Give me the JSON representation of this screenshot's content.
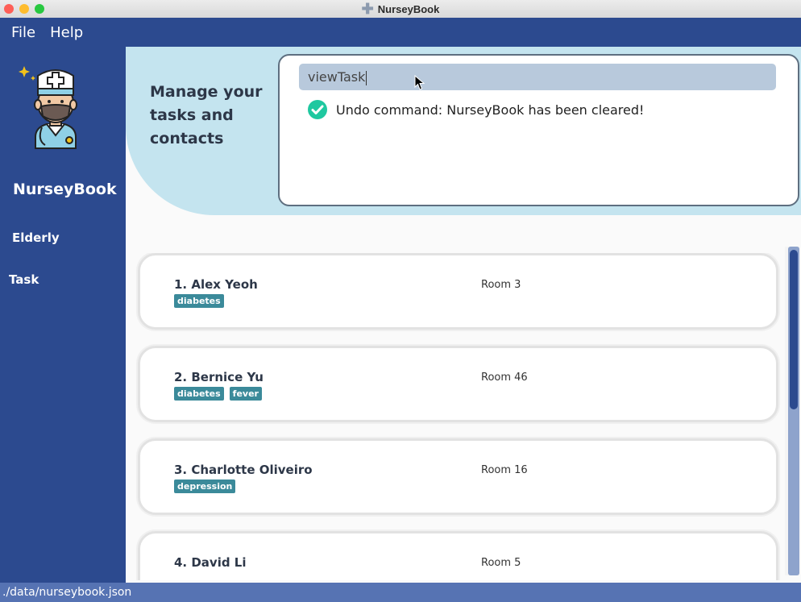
{
  "window": {
    "title": "NurseyBook",
    "title_icon": "plus-icon"
  },
  "menu": {
    "file_label": "File",
    "help_label": "Help"
  },
  "sidebar": {
    "brand": "NurseyBook",
    "avatar_icon": "nurse-avatar-icon",
    "items": [
      {
        "label": "Elderly"
      },
      {
        "label": "Task"
      }
    ]
  },
  "header": {
    "tagline": "Manage your tasks and contacts"
  },
  "command": {
    "input_value": "viewTask",
    "result_icon": "check-circle-icon",
    "result_text": "Undo command: NurseyBook has been cleared!"
  },
  "list": {
    "items": [
      {
        "name": "1. Alex Yeoh",
        "room": "Room 3",
        "tags": [
          "diabetes"
        ]
      },
      {
        "name": "2. Bernice Yu",
        "room": "Room 46",
        "tags": [
          "diabetes",
          "fever"
        ]
      },
      {
        "name": "3. Charlotte Oliveiro",
        "room": "Room 16",
        "tags": [
          "depression"
        ]
      },
      {
        "name": "4. David Li",
        "room": "Room 5",
        "tags": []
      }
    ]
  },
  "status": {
    "path": "./data/nurseybook.json"
  },
  "colors": {
    "primary": "#2c4a8f",
    "header_bg": "#c4e4ef",
    "tag_bg": "#3b8a9a",
    "success": "#1fc8a0"
  }
}
